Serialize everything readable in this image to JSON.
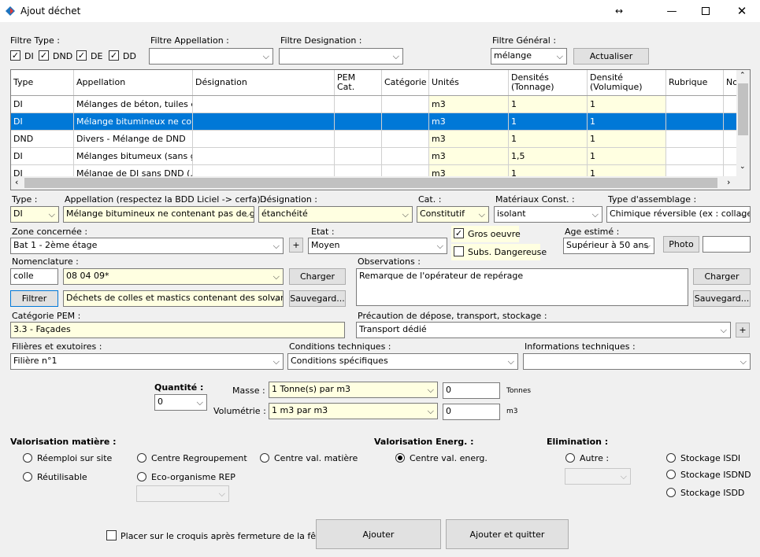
{
  "window": {
    "title": "Ajout déchet"
  },
  "filters": {
    "type_label": "Filtre Type :",
    "types": [
      {
        "label": "DI",
        "checked": true
      },
      {
        "label": "DND",
        "checked": true
      },
      {
        "label": "DE",
        "checked": true
      },
      {
        "label": "DD",
        "checked": true
      }
    ],
    "appellation_label": "Filtre Appellation :",
    "appellation_value": "",
    "designation_label": "Filtre Designation :",
    "designation_value": "",
    "general_label": "Filtre Général :",
    "general_value": "mélange",
    "refresh": "Actualiser"
  },
  "grid": {
    "headers": [
      "Type",
      "Appellation",
      "Désignation",
      "PEM\nCat.",
      "Catégorie",
      "Unités",
      "Densités\n(Tonnage)",
      "Densité\n(Volumique)",
      "Rubrique",
      "No"
    ],
    "rows": [
      [
        "DI",
        "Mélanges de béton, tuiles et...",
        "",
        "",
        "",
        "m3",
        "1",
        "1",
        ""
      ],
      [
        "DI",
        "Mélange bitumineux ne cont...",
        "",
        "",
        "",
        "m3",
        "1",
        "1",
        ""
      ],
      [
        "DND",
        "Divers - Mélange de DND",
        "",
        "",
        "",
        "m3",
        "1",
        "1",
        ""
      ],
      [
        "DI",
        "Mélanges bitumeux (sans g...",
        "",
        "",
        "",
        "m3",
        "1,5",
        "1",
        ""
      ],
      [
        "DI",
        "Mélange de DI sans DND (...",
        "",
        "",
        "",
        "m3",
        "1",
        "1",
        ""
      ]
    ],
    "selected_row": 1
  },
  "form": {
    "type_label": "Type :",
    "type_value": "DI",
    "appellation_label": "Appellation (respectez la BDD Liciel -> cerfa) :",
    "appellation_value": "Mélange bitumineux ne contenant pas de goudr",
    "designation_label": "Désignation :",
    "designation_value": "étanchéité",
    "cat_label": "Cat. :",
    "cat_value": "Constitutif",
    "materiaux_label": "Matériaux Const. :",
    "materiaux_value": "isolant",
    "assemblage_label": "Type d'assemblage :",
    "assemblage_value": "Chimique réversible (ex : collage re",
    "zone_label": "Zone concernée :",
    "zone_value": "Bat 1 - 2ème étage",
    "etat_label": "Etat :",
    "etat_value": "Moyen",
    "gros_oeuvre": "Gros oeuvre",
    "subs_dangereuse": "Subs. Dangereuse",
    "age_label": "Age estimé :",
    "age_value": "Supérieur à 50 ans",
    "photo": "Photo",
    "nomenclature_label": "Nomenclature :",
    "nomenclature_search": "colle",
    "nomenclature_code": "08 04 09*",
    "charger": "Charger",
    "filtrer": "Filtrer",
    "nomenclature_desc": "Déchets de colles et mastics contenant des solvants o",
    "sauvegard": "Sauvegard...",
    "observations_label": "Observations :",
    "observations_value": "Remarque de l'opérateur de repérage",
    "pem_label": "Catégorie PEM :",
    "pem_value": "3.3 - Façades",
    "precaution_label": "Précaution de dépose, transport, stockage :",
    "precaution_value": "Transport dédié",
    "filieres_label": "Filières et exutoires :",
    "filieres_value": "Filière n°1",
    "conditions_label": "Conditions techniques :",
    "conditions_value": "Conditions spécifiques",
    "infos_label": "Informations techniques :",
    "infos_value": "",
    "quantite_label": "Quantité :",
    "quantite_value": "0",
    "masse_label": "Masse :",
    "masse_value": "1 Tonne(s) par m3",
    "masse_qty": "0",
    "masse_unit": "Tonnes",
    "volumetrie_label": "Volumétrie :",
    "volumetrie_value": "1 m3 par m3",
    "volumetrie_qty": "0",
    "volumetrie_unit": "m3",
    "plus": "+"
  },
  "valorisation": {
    "matiere_label": "Valorisation matière :",
    "reemploi": "Réemploi sur site",
    "reutilisable": "Réutilisable",
    "centre_regroupement": "Centre Regroupement",
    "eco_organisme": "Eco-organisme REP",
    "centre_val_matiere": "Centre val. matière",
    "energ_label": "Valorisation Energ. :",
    "centre_val_energ": "Centre val. energ.",
    "elimination_label": "Elimination :",
    "autre": "Autre :",
    "isdi": "Stockage ISDI",
    "isdnd": "Stockage ISDND",
    "isdd": "Stockage ISDD"
  },
  "footer": {
    "placer": "Placer sur le croquis après fermeture de la fênetre",
    "ajouter": "Ajouter",
    "ajouter_quitter": "Ajouter et quitter"
  }
}
